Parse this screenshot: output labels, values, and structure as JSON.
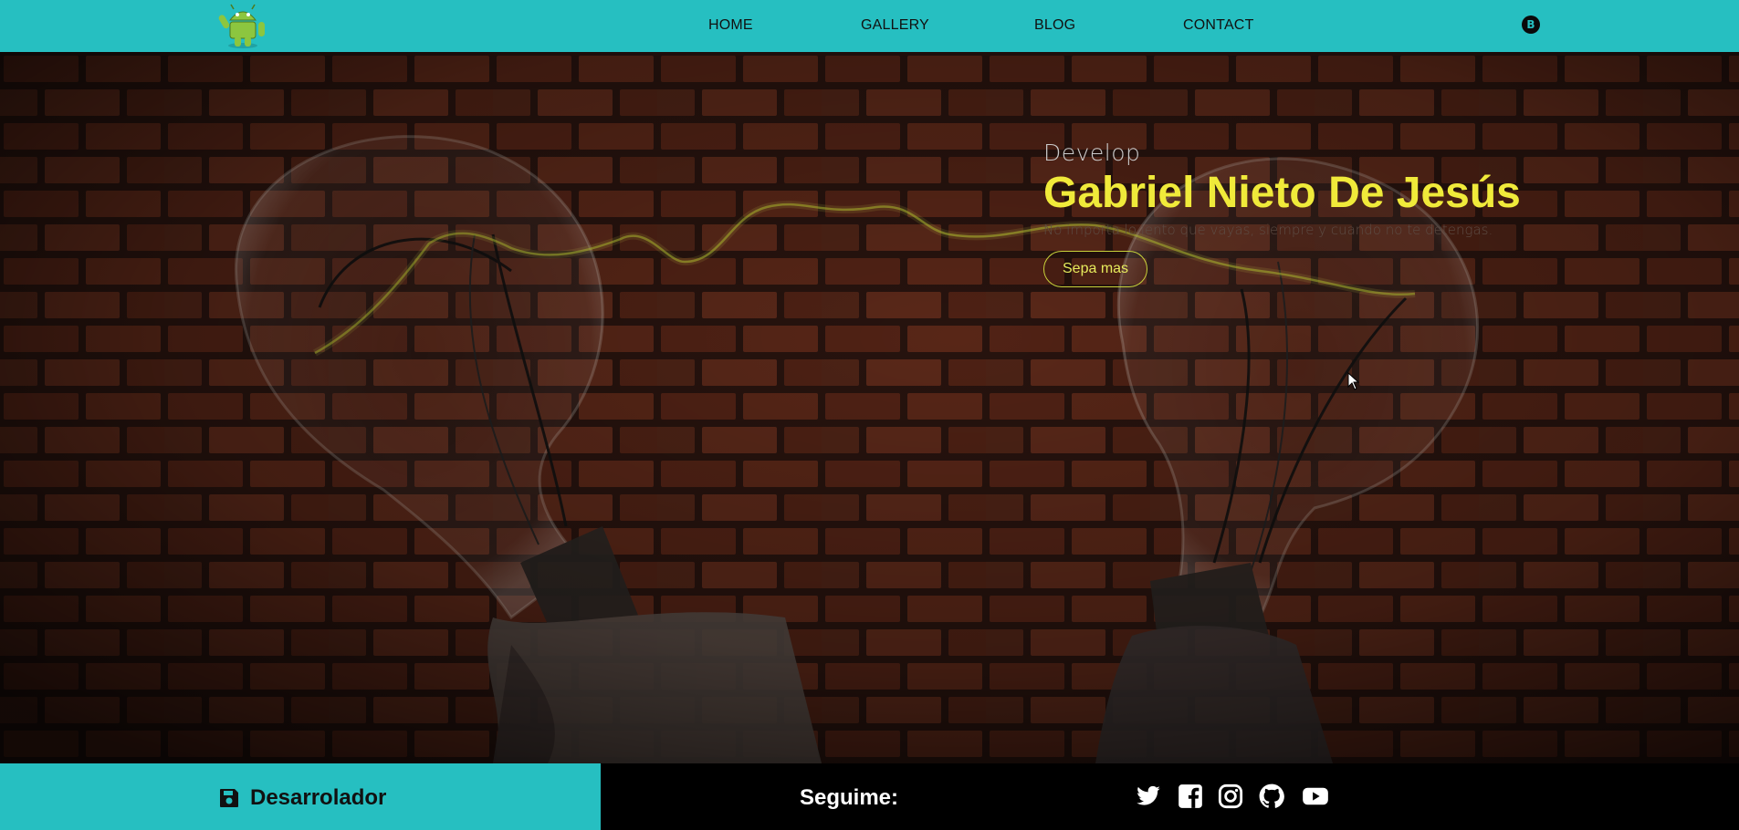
{
  "nav": {
    "items": [
      "HOME",
      "GALLERY",
      "BLOG",
      "CONTACT"
    ],
    "logo": "android-robot-icon",
    "crypto": "B"
  },
  "hero": {
    "eyebrow": "Develop",
    "name": "Gabriel Nieto De Jesús",
    "tagline": "No importa lo lento que vayas, siempre y cuando no te detengas.",
    "cta": "Sepa mas"
  },
  "footer": {
    "brand": "Desarrolador",
    "follow": "Seguime:",
    "social_icons": [
      "twitter-icon",
      "facebook-icon",
      "instagram-icon",
      "github-icon",
      "youtube-icon"
    ]
  },
  "colors": {
    "accent": "#26bfc1",
    "title": "#f0ea3a",
    "brick": "#6b2f1e"
  }
}
